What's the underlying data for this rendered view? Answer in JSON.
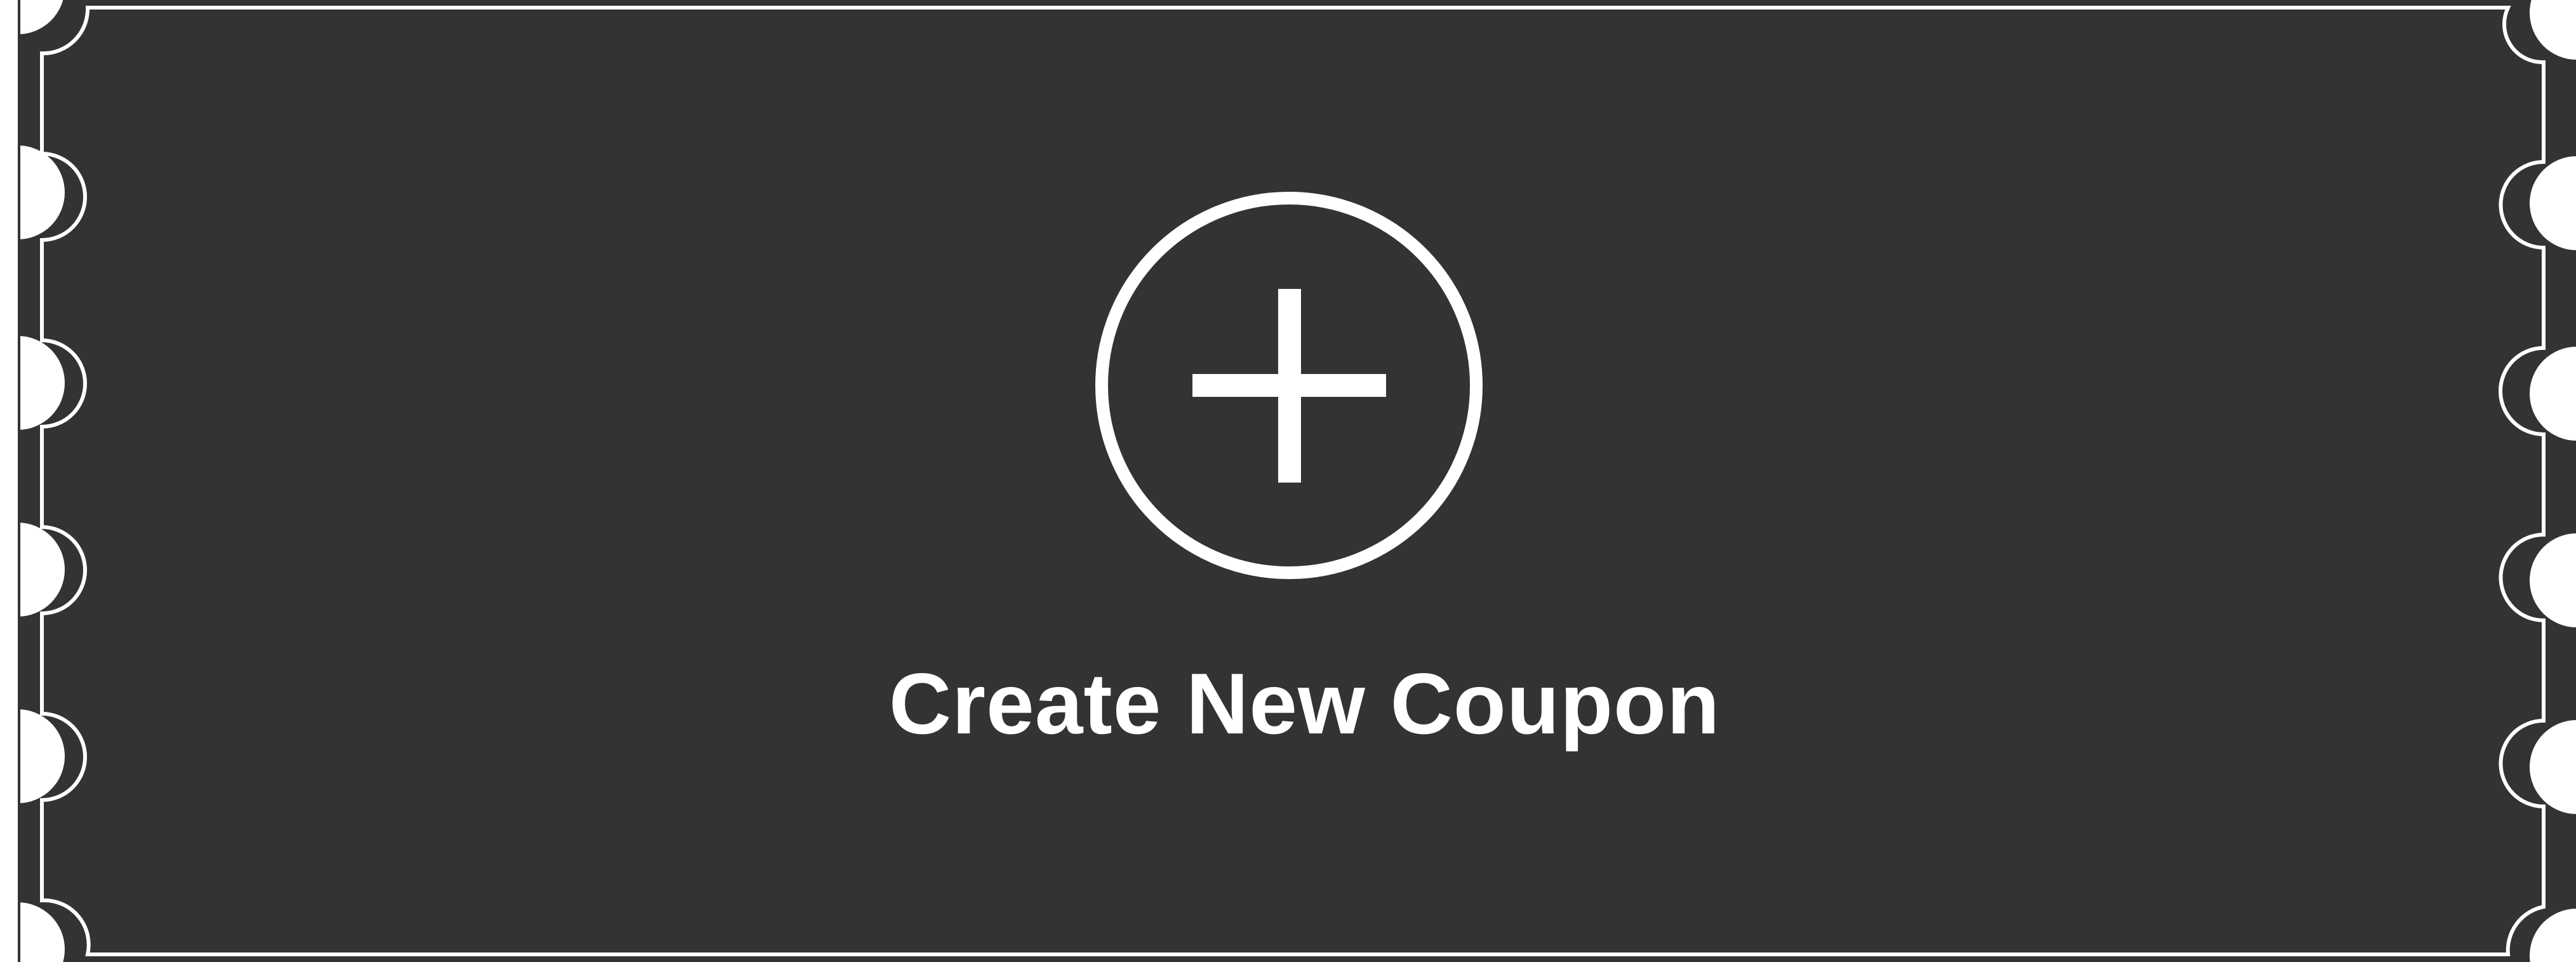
{
  "coupon": {
    "action_label": "Create New Coupon",
    "icon": "plus-in-circle-icon"
  },
  "colors": {
    "card_background": "#333333",
    "outline": "#ffffff",
    "page_background": "#ffffff",
    "text": "#ffffff"
  }
}
